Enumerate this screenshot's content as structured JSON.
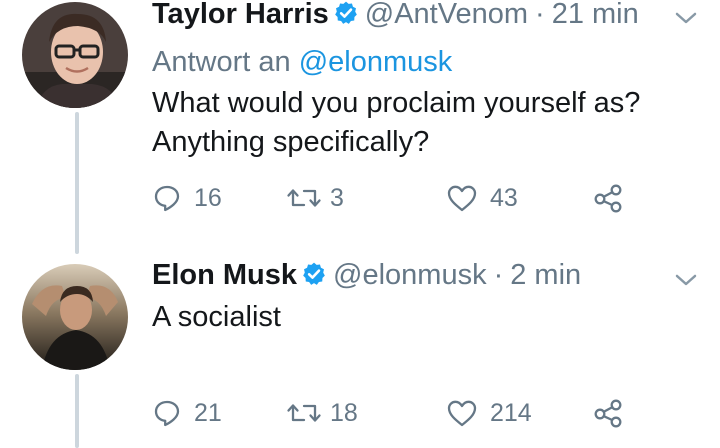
{
  "tweets": [
    {
      "display_name": "Taylor Harris",
      "handle": "@AntVenom",
      "separator": "·",
      "time": "21 min",
      "reply_prefix": "Antwort an",
      "reply_mention": "@elonmusk",
      "text_lines": [
        "What would you proclaim yourself as?",
        "Anything specifically?"
      ],
      "replies": "16",
      "retweets": "3",
      "likes": "43",
      "verified": true
    },
    {
      "display_name": "Elon Musk",
      "handle": "@elonmusk",
      "separator": "·",
      "time": "2 min",
      "text_lines": [
        "A socialist"
      ],
      "replies": "21",
      "retweets": "18",
      "likes": "214",
      "verified": true
    }
  ],
  "icons": {
    "reply": "reply-icon",
    "retweet": "retweet-icon",
    "like": "heart-icon",
    "share": "share-icon",
    "verified": "verified-badge-icon",
    "caret": "chevron-down-icon"
  },
  "colors": {
    "text": "#14171a",
    "muted": "#657786",
    "link": "#1b95e0",
    "verified": "#1da1f2",
    "thread_line": "#cdd6dd"
  }
}
